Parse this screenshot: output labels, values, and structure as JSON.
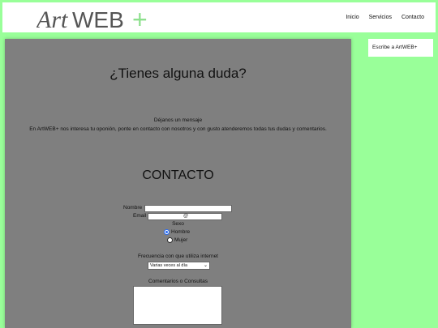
{
  "brand": {
    "logo_text_art": "Art",
    "logo_text_web": "WEB",
    "logo_plus": "+"
  },
  "nav": {
    "items": [
      "Inicio",
      "Servicios",
      "Contacto"
    ]
  },
  "main": {
    "question": "¿Tienes alguna duda?",
    "intro_line1": "Déjanos un mensaje",
    "intro_line2": "En ArtWEB+ nos interesa tu oponión, ponte en contacto con nosotros y con gusto atenderemos todas tus dudas y comentarios.",
    "contact_title": "CONTACTO"
  },
  "form": {
    "name_label": "Nombre",
    "name_value": "",
    "email_label": "Email",
    "email_value": "@",
    "sex_label": "Sexo",
    "sex_options": [
      "Hombre",
      "Mujer"
    ],
    "sex_selected": "Hombre",
    "frequency_label": "Frecuencia con que utiliza internet",
    "frequency_selected": "Varias veces al día",
    "comments_label": "Comentarios o Consultas"
  },
  "sidebar": {
    "label": "Escribe a ArtWEB+"
  },
  "colors": {
    "background": "#99ff99",
    "main_panel": "#7f7f7f",
    "logo_gray": "#555555",
    "logo_green": "#8ee08e"
  }
}
